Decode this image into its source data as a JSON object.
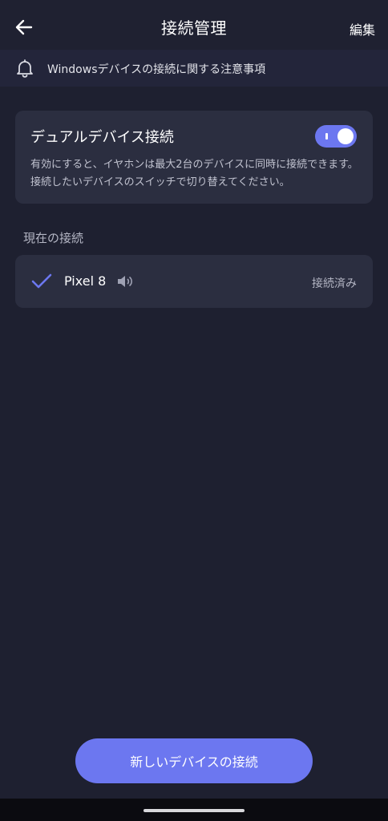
{
  "header": {
    "title": "接続管理",
    "edit_label": "編集",
    "back_icon": "arrow-left-icon"
  },
  "notice": {
    "icon": "bell-icon",
    "text": "Windowsデバイスの接続に関する注意事項"
  },
  "dual_device": {
    "title": "デュアルデバイス接続",
    "enabled": true,
    "description": "有効にすると、イヤホンは最大2台のデバイスに同時に接続できます。接続したいデバイスのスイッチで切り替えてください。"
  },
  "current_connection": {
    "section_label": "現在の接続",
    "devices": [
      {
        "name": "Pixel 8",
        "status": "接続済み",
        "icons": [
          "check-icon",
          "speaker-icon"
        ]
      }
    ]
  },
  "footer": {
    "connect_button_label": "新しいデバイスの接続"
  },
  "colors": {
    "background": "#1e2030",
    "card": "#2b2e40",
    "accent": "#6c77f0"
  }
}
